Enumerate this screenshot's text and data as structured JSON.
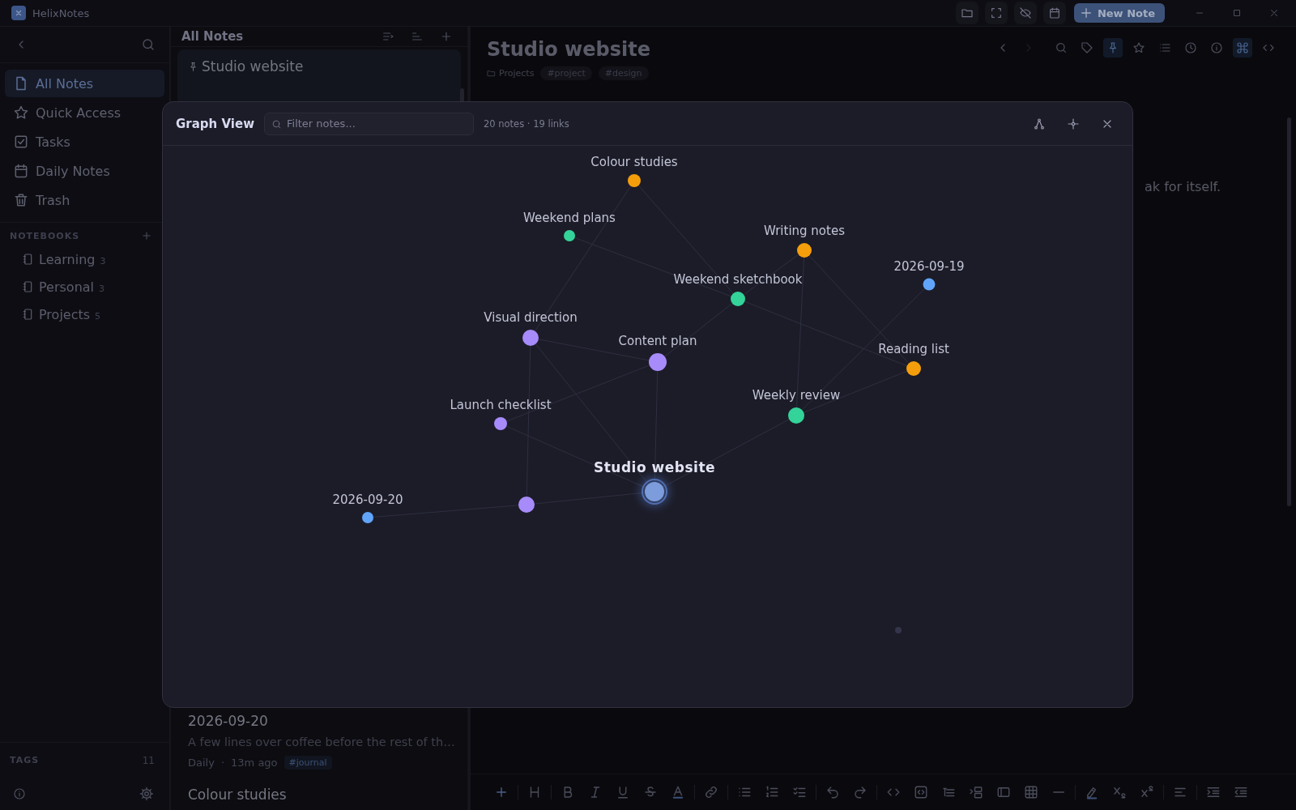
{
  "app": {
    "title": "HelixNotes",
    "new_note": "New Note"
  },
  "sidebar": {
    "nav": [
      {
        "label": "All Notes",
        "selected": true
      },
      {
        "label": "Quick Access",
        "selected": false
      },
      {
        "label": "Tasks",
        "selected": false
      },
      {
        "label": "Daily Notes",
        "selected": false
      },
      {
        "label": "Trash",
        "selected": false
      }
    ],
    "notebooks_heading": "NOTEBOOKS",
    "notebooks": [
      {
        "label": "Learning",
        "count": "3"
      },
      {
        "label": "Personal",
        "count": "3"
      },
      {
        "label": "Projects",
        "count": "5"
      }
    ],
    "tags_heading": "TAGS",
    "tags_count": "11"
  },
  "note_list": {
    "title": "All Notes",
    "notes": [
      {
        "title": "Studio website",
        "pinned": true,
        "selected": true
      },
      {
        "title": "2026-09-20",
        "pinned": false,
        "selected": false,
        "preview": "A few lines over coffee before the rest of th…",
        "notebook": "Daily",
        "separator": "·",
        "time": "13m ago",
        "tag": "#journal"
      },
      {
        "title": "Colour studies",
        "pinned": false,
        "selected": false
      }
    ]
  },
  "editor": {
    "title": "Studio website",
    "folder": "Projects",
    "tags": [
      "#project",
      "#design"
    ],
    "tools": [
      {
        "active": false,
        "disabled": false
      },
      {
        "active": false,
        "disabled": true
      },
      {
        "active": false,
        "disabled": false
      },
      {
        "active": false,
        "disabled": false
      },
      {
        "active": true,
        "disabled": false
      },
      {
        "active": false,
        "disabled": false
      },
      {
        "active": false,
        "disabled": false
      },
      {
        "active": false,
        "disabled": false
      },
      {
        "active": false,
        "disabled": false
      },
      {
        "active": true,
        "disabled": false
      },
      {
        "active": false,
        "disabled": false
      }
    ],
    "body": "ak for itself."
  },
  "graph": {
    "title": "Graph View",
    "filter_placeholder": "Filter notes...",
    "stats": "20 notes · 19 links",
    "nodes": [
      {
        "label": "Colour studies",
        "color": "#f59e0b",
        "selected": false
      },
      {
        "label": "Weekend plans",
        "color": "#34d399",
        "selected": false
      },
      {
        "label": "Writing notes",
        "color": "#f59e0b",
        "selected": false
      },
      {
        "label": "2026-09-19",
        "color": "#60a5fa",
        "selected": false
      },
      {
        "label": "Weekend sketchbook",
        "color": "#34d399",
        "selected": false
      },
      {
        "label": "Visual direction",
        "color": "#a78bfa",
        "selected": false
      },
      {
        "label": "Content plan",
        "color": "#a78bfa",
        "selected": false
      },
      {
        "label": "Reading list",
        "color": "#f59e0b",
        "selected": false
      },
      {
        "label": "Launch checklist",
        "color": "#a78bfa",
        "selected": false
      },
      {
        "label": "Weekly review",
        "color": "#34d399",
        "selected": false
      },
      {
        "label": "Studio website",
        "color": "#7c9cdb",
        "selected": true
      },
      {
        "color": "#a78bfa",
        "selected": false
      },
      {
        "label": "2026-09-20",
        "color": "#60a5fa",
        "selected": false
      },
      {
        "color": "#34344a",
        "selected": false
      }
    ]
  }
}
